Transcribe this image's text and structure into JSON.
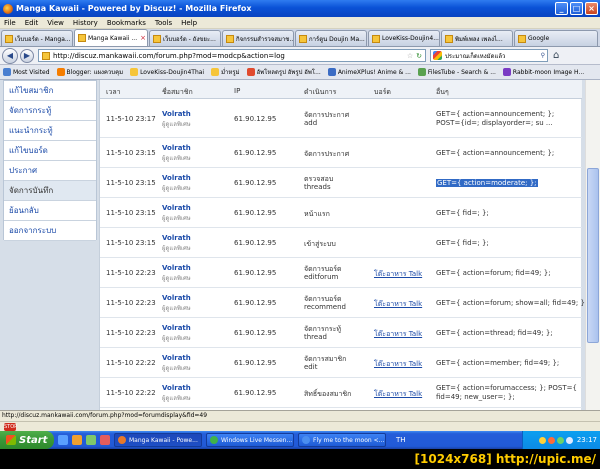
{
  "window": {
    "title": "Manga Kawaii - Powered by Discuz! - Mozilla Firefox"
  },
  "menu": [
    "File",
    "Edit",
    "View",
    "History",
    "Bookmarks",
    "Tools",
    "Help"
  ],
  "tabs": [
    {
      "label": "เว็บบอร์ด - Manga...",
      "active": false
    },
    {
      "label": "Manga Kawaii ...",
      "active": true
    },
    {
      "label": "เว็บบอร์ด - ถังขยะ...",
      "active": false
    },
    {
      "label": "กิจกรรมสำรวจสมาช...",
      "active": false
    },
    {
      "label": "การ์ตูน Doujin Ma...",
      "active": false
    },
    {
      "label": "LoveKiss-Doujin4...",
      "active": false
    },
    {
      "label": "พิมพ์เพลง เพลงไ...",
      "active": false
    },
    {
      "label": "Google",
      "active": false
    }
  ],
  "nav": {
    "url": "http://discuz.mankawaii.com/forum.php?mod=modcp&action=log",
    "search": "ประมาณเก็ดเหงมัดแล้ว"
  },
  "bookmarks": [
    {
      "label": "Most Visited",
      "color": "#4a7fd0"
    },
    {
      "label": "Blogger: แผงควบคุม",
      "color": "#f57d00"
    },
    {
      "label": "LoveKiss-Doujin4Thai",
      "color": "#f6c53a"
    },
    {
      "label": "ม่ำหรูม่",
      "color": "#f6c53a"
    },
    {
      "label": "อัพโหลดรูป อัพรูป อัพโ...",
      "color": "#e04a2e"
    },
    {
      "label": "AnimeXPlus! Anime & ...",
      "color": "#3b6cc4"
    },
    {
      "label": "FilesTube - Search & ...",
      "color": "#59a14f"
    },
    {
      "label": "Rabbit-moon Image H...",
      "color": "#7a3bc4"
    }
  ],
  "sidebar": [
    {
      "label": "แก้ไขสมาชิก",
      "active": false
    },
    {
      "label": "จัดการกระทู้",
      "active": false
    },
    {
      "label": "แนะนำกระทู้",
      "active": false
    },
    {
      "label": "แก้ไขบอร์ด",
      "active": false
    },
    {
      "label": "ประกาศ",
      "active": false
    },
    {
      "label": "จัดการบันทึก",
      "active": true
    },
    {
      "label": "ย้อนกลับ",
      "active": false
    },
    {
      "label": "ออกจากระบบ",
      "active": false
    }
  ],
  "table": {
    "headers": {
      "time": "เวลา",
      "member": "ชื่อสมาชิก",
      "ip": "IP",
      "action": "ดำเนินการ",
      "board": "บอร์ด",
      "other": "อื่นๆ"
    },
    "rows": [
      {
        "time": "11-5-10 23:17",
        "user": "Volrath",
        "group": "ผู้ดูแลพิเศษ",
        "ip": "61.90.12.95",
        "action1": "จัดการประกาศ",
        "action2": "add",
        "board": "",
        "other1": "GET={ action=announcement; };",
        "other2": "POST={id=; displayorder=; su ...",
        "highlight": false
      },
      {
        "time": "11-5-10 23:15",
        "user": "Volrath",
        "group": "ผู้ดูแลพิเศษ",
        "ip": "61.90.12.95",
        "action1": "จัดการประกาศ",
        "action2": "",
        "board": "",
        "other1": "GET={ action=announcement; };",
        "other2": "",
        "highlight": false
      },
      {
        "time": "11-5-10 23:15",
        "user": "Volrath",
        "group": "ผู้ดูแลพิเศษ",
        "ip": "61.90.12.95",
        "action1": "ตรวจสอบ",
        "action2": "threads",
        "board": "",
        "other1": "GET={ action=moderate; };",
        "other2": "",
        "highlight": true
      },
      {
        "time": "11-5-10 23:15",
        "user": "Volrath",
        "group": "ผู้ดูแลพิเศษ",
        "ip": "61.90.12.95",
        "action1": "หน้าแรก",
        "action2": "",
        "board": "",
        "other1": "GET={ fid=; };",
        "other2": "",
        "highlight": false
      },
      {
        "time": "11-5-10 23:15",
        "user": "Volrath",
        "group": "ผู้ดูแลพิเศษ",
        "ip": "61.90.12.95",
        "action1": "เข้าสู่ระบบ",
        "action2": "",
        "board": "",
        "other1": "GET={ fid=; };",
        "other2": "",
        "highlight": false
      },
      {
        "time": "11-5-10 22:23",
        "user": "Volrath",
        "group": "ผู้ดูแลพิเศษ",
        "ip": "61.90.12.95",
        "action1": "จัดการบอร์ด",
        "action2": "editforum",
        "board": "โต๊ะอาหาร Talk",
        "other1": "GET={ action=forum; fid=49; };",
        "other2": "",
        "highlight": false
      },
      {
        "time": "11-5-10 22:23",
        "user": "Volrath",
        "group": "ผู้ดูแลพิเศษ",
        "ip": "61.90.12.95",
        "action1": "จัดการบอร์ด",
        "action2": "recommend",
        "board": "โต๊ะอาหาร Talk",
        "other1": "GET={ action=forum; show=all; fid=49; };",
        "other2": "",
        "highlight": false
      },
      {
        "time": "11-5-10 22:23",
        "user": "Volrath",
        "group": "ผู้ดูแลพิเศษ",
        "ip": "61.90.12.95",
        "action1": "จัดการกระทู้",
        "action2": "thread",
        "board": "โต๊ะอาหาร Talk",
        "other1": "GET={ action=thread; fid=49; };",
        "other2": "",
        "highlight": false
      },
      {
        "time": "11-5-10 22:22",
        "user": "Volrath",
        "group": "ผู้ดูแลพิเศษ",
        "ip": "61.90.12.95",
        "action1": "จัดการสมาชิก",
        "action2": "edit",
        "board": "โต๊ะอาหาร Talk",
        "other1": "GET={ action=member; fid=49; };",
        "other2": "",
        "highlight": false
      },
      {
        "time": "11-5-10 22:22",
        "user": "Volrath",
        "group": "ผู้ดูแลพิเศษ",
        "ip": "61.90.12.95",
        "action1": "สิทธิ์ของสมาชิก",
        "action2": "",
        "board": "โต๊ะอาหาร Talk",
        "other1": "GET={ action=forumaccess; }; POST={",
        "other2": "fid=49; new_user=; };",
        "highlight": false
      },
      {
        "time": "11-5-10 22:22",
        "user": "Volrath",
        "group": "ผู้ดูแลพิเศษ",
        "ip": "61.90.12.95",
        "action1": "สิทธิ์ของสมาชิก",
        "action2": "",
        "board": "โต๊ะอาหาร Talk",
        "other1": "GET={ action=forumaccess; };",
        "other2": "",
        "highlight": false
      }
    ]
  },
  "status": {
    "text": "http://discuz.mankawaii.com/forum.php?mod=forumdisplay&fid=49"
  },
  "addon": {
    "stop": "STOP"
  },
  "taskbar": {
    "start": "Start",
    "tasks": [
      {
        "label": "Manga Kawaii - Powe...",
        "color": "#e8792a",
        "active": true
      },
      {
        "label": "Windows Live Messen...",
        "color": "#3fb24a",
        "active": false
      },
      {
        "label": "Fly me to the moon <...",
        "color": "#4a8ef0",
        "active": false
      }
    ],
    "lang": "TH",
    "clock": "23:17"
  },
  "footer": {
    "text": "[1024x768] http://upic.me/"
  }
}
